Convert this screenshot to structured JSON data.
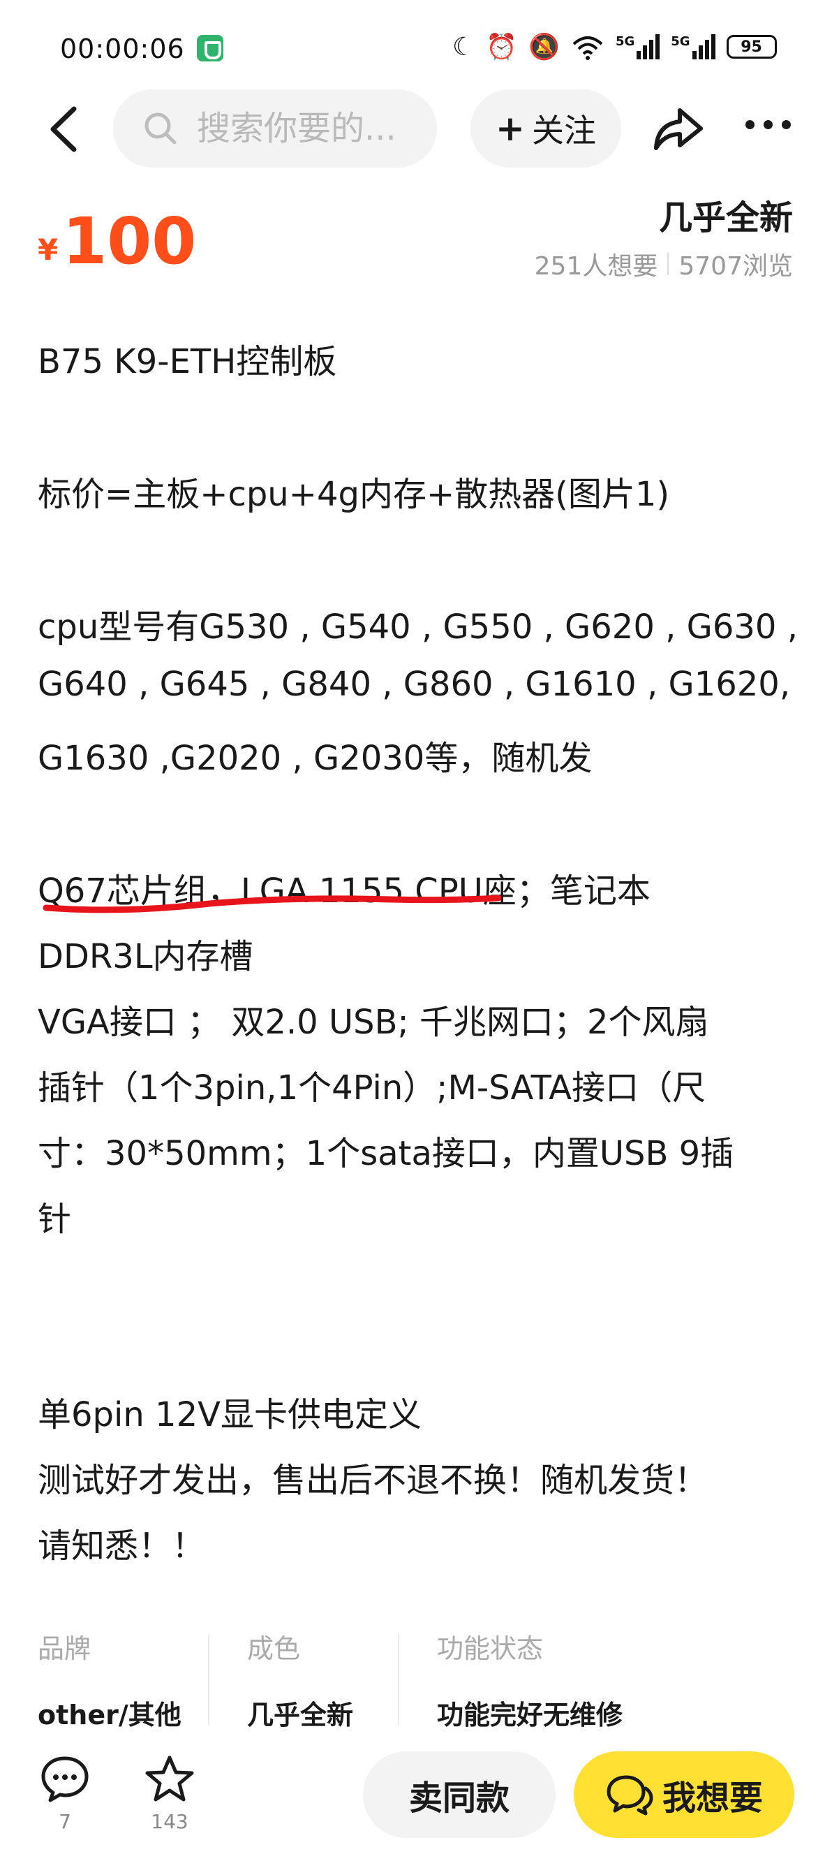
{
  "status_bar": {
    "time": "00:00:06",
    "battery": "95",
    "network_label": "5G"
  },
  "nav": {
    "search_placeholder": "搜索你要的...",
    "follow_label": "关注",
    "follow_prefix": "+"
  },
  "item": {
    "currency_symbol": "¥",
    "price": "100",
    "condition": "几乎全新",
    "want_count": "251人想要",
    "view_count": "5707浏览",
    "description_lines": [
      "B75  K9-ETH控制板",
      "标价=主板+cpu+4g内存+散热器(图片1)",
      "cpu型号有G530 , G540 , G550 , G620 , G630 ,",
      "G640 , G645 , G840 ,  G860 , G1610 , G1620,",
      "G1630 ,G2020 , G2030等，随机发",
      "Q67芯片组，LGA 1155 CPU座；笔记本",
      "DDR3L内存槽",
      "VGA接口 ； 双2.0 USB; 千兆网口；2个风扇",
      "插针（1个3pin,1个4Pin）;M-SATA接口（尺",
      "寸：30*50mm；1个sata接口，内置USB 9插",
      "针",
      "单6pin 12V显卡供电定义",
      "测试好才发出，售出后不退不换！随机发货！",
      "请知悉！！"
    ]
  },
  "attributes": [
    {
      "label": "品牌",
      "value": "other/其他"
    },
    {
      "label": "成色",
      "value": "几乎全新"
    },
    {
      "label": "功能状态",
      "value": "功能完好无维修"
    }
  ],
  "bottom_bar": {
    "comment_count": "7",
    "favorite_count": "143",
    "same_item_label": "卖同款",
    "want_label": "我想要"
  },
  "colors": {
    "price": "#ff4e1a",
    "accent_yellow": "#ffe033",
    "annotation_red": "#e8141b"
  }
}
